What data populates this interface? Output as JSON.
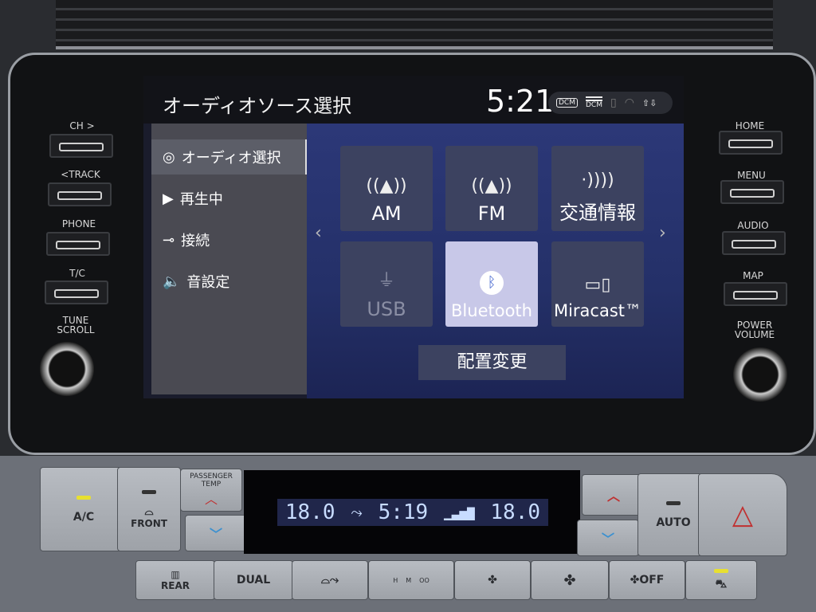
{
  "screen": {
    "title": "オーディオソース選択",
    "clock": "5:21",
    "status": {
      "dcm_badge": "DCM",
      "dcm_signal_label": "DCM",
      "icons": [
        "dcm-icon",
        "signal-bars-icon",
        "phone-disconnected-icon",
        "wifi-icon",
        "data-transfer-icon"
      ]
    },
    "menu": [
      {
        "label": "オーディオ選択",
        "icon": "audio-source-icon",
        "selected": true
      },
      {
        "label": "再生中",
        "icon": "play-icon"
      },
      {
        "label": "接続",
        "icon": "connection-icon"
      },
      {
        "label": "音設定",
        "icon": "speaker-icon"
      }
    ],
    "tiles": [
      {
        "label": "AM",
        "icon": "antenna-icon"
      },
      {
        "label": "FM",
        "icon": "antenna-icon"
      },
      {
        "label": "交通情報",
        "icon": "traffic-broadcast-icon"
      },
      {
        "label": "USB",
        "icon": "usb-icon",
        "disabled": true
      },
      {
        "label": "Bluetooth",
        "icon": "bluetooth-icon",
        "selected": true
      },
      {
        "label": "Miracast™",
        "icon": "miracast-icon"
      }
    ],
    "relayout_label": "配置変更",
    "prev": "‹",
    "next": "›"
  },
  "hardware": {
    "left": [
      "CH >",
      "<TRACK",
      "PHONE",
      "T/C"
    ],
    "left_knob": "TUNE\nSCROLL",
    "right": [
      "HOME",
      "MENU",
      "AUDIO",
      "MAP"
    ],
    "right_knob": "POWER\nVOLUME"
  },
  "climate": {
    "ac": "A/C",
    "front": "FRONT",
    "passenger_temp": "PASSENGER\nTEMP",
    "auto": "AUTO",
    "rear": "REAR",
    "dual": "DUAL",
    "off": "OFF",
    "fan_levels": [
      "H",
      "M",
      "OO"
    ],
    "display": {
      "left_temp": "18.0",
      "time": "5:19",
      "right_temp": "18.0"
    },
    "accent_red": "#c03030",
    "accent_blue": "#3a90d0",
    "led_on": "#e8e030"
  }
}
